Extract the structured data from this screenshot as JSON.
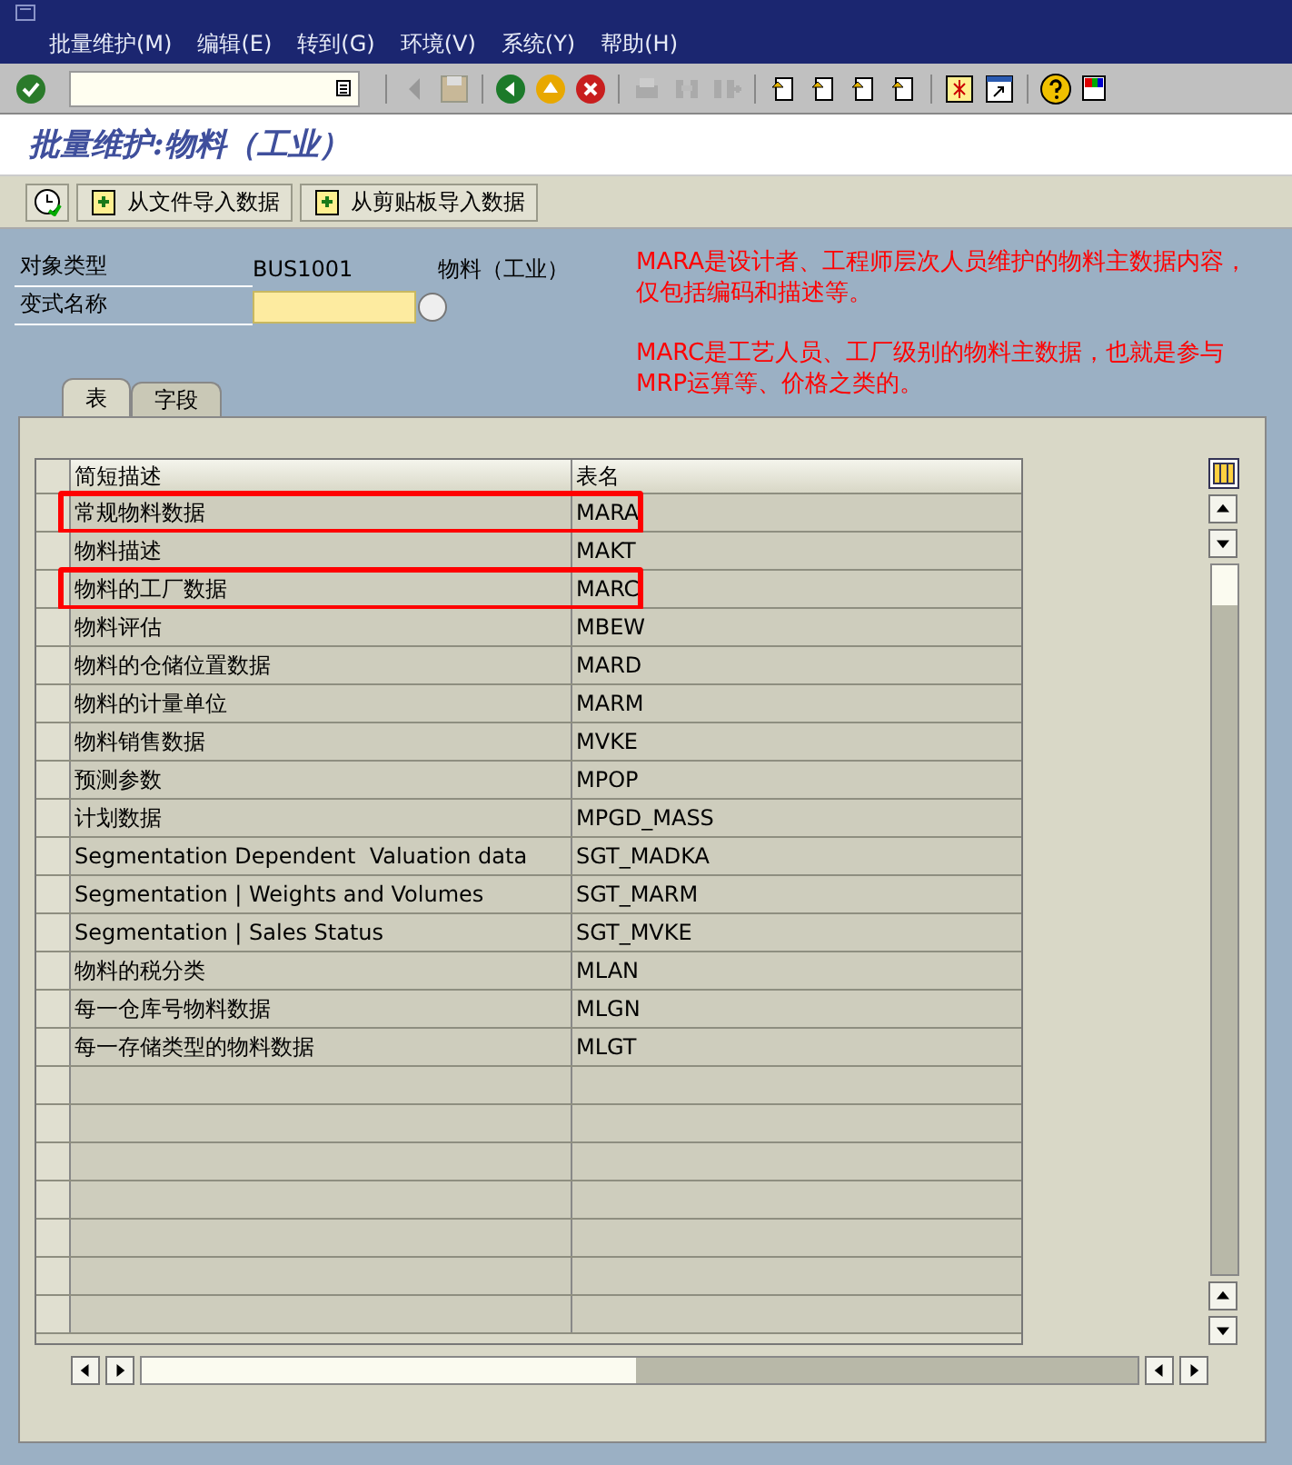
{
  "menu": [
    "批量维护(M)",
    "编辑(E)",
    "转到(G)",
    "环境(V)",
    "系统(Y)",
    "帮助(H)"
  ],
  "title": "批量维护:物料（工业）",
  "app_toolbar": [
    {
      "kind": "icon"
    },
    {
      "kind": "button",
      "label": "从文件导入数据"
    },
    {
      "kind": "button",
      "label": "从剪贴板导入数据"
    }
  ],
  "fields": [
    {
      "label": "对象类型",
      "value": "BUS1001",
      "description": "物料（工业）",
      "kind": "display"
    },
    {
      "label": "变式名称",
      "kind": "input"
    }
  ],
  "notes": [
    "MARA是设计者、工程师层次人员维护的物料主数据内容，仅包括编码和描述等。",
    "MARC是工艺人员、工厂级别的物料主数据，也就是参与MRP运算等、价格之类的。"
  ],
  "tabs": [
    {
      "label": "表",
      "selected": true
    },
    {
      "label": "字段",
      "selected": false
    }
  ],
  "table": {
    "columns": [
      "简短描述",
      "表名"
    ],
    "rows": [
      {
        "description": "常规物料数据",
        "name": "MARA",
        "highlighted": true
      },
      {
        "description": "物料描述",
        "name": "MAKT",
        "highlighted": false
      },
      {
        "description": "物料的工厂数据",
        "name": "MARC",
        "highlighted": true
      },
      {
        "description": "物料评估",
        "name": "MBEW",
        "highlighted": false
      },
      {
        "description": "物料的仓储位置数据",
        "name": "MARD",
        "highlighted": false
      },
      {
        "description": "物料的计量单位",
        "name": "MARM",
        "highlighted": false
      },
      {
        "description": "物料销售数据",
        "name": "MVKE",
        "highlighted": false
      },
      {
        "description": "预测参数",
        "name": "MPOP",
        "highlighted": false
      },
      {
        "description": "计划数据",
        "name": "MPGD_MASS",
        "highlighted": false
      },
      {
        "description": "Segmentation Dependent  Valuation data",
        "name": "SGT_MADKA",
        "highlighted": false
      },
      {
        "description": "Segmentation | Weights and Volumes",
        "name": "SGT_MARM",
        "highlighted": false
      },
      {
        "description": "Segmentation | Sales Status",
        "name": "SGT_MVKE",
        "highlighted": false
      },
      {
        "description": "物料的税分类",
        "name": "MLAN",
        "highlighted": false
      },
      {
        "description": "每一仓库号物料数据",
        "name": "MLGN",
        "highlighted": false
      },
      {
        "description": "每一存储类型的物料数据",
        "name": "MLGT",
        "highlighted": false
      }
    ]
  }
}
